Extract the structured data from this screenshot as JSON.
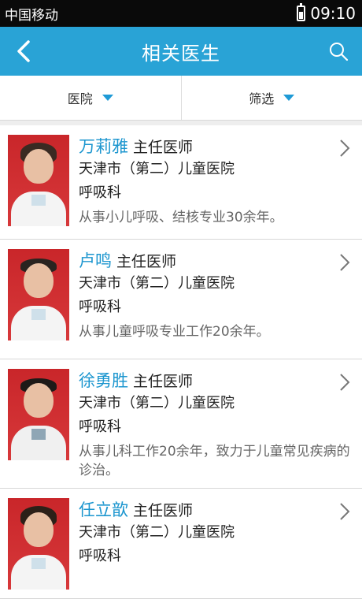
{
  "status_bar": {
    "carrier": "中国移动",
    "time": "09:10"
  },
  "header": {
    "title": "相关医生"
  },
  "filters": [
    {
      "label": "医院"
    },
    {
      "label": "筛选"
    }
  ],
  "doctors": [
    {
      "name": "万莉雅",
      "title": "主任医师",
      "hospital": "天津市（第二）儿童医院",
      "department": "呼吸科",
      "description": "从事小儿呼吸、结核专业30余年。"
    },
    {
      "name": "卢鸣",
      "title": "主任医师",
      "hospital": "天津市（第二）儿童医院",
      "department": "呼吸科",
      "description": "从事儿童呼吸专业工作20余年。"
    },
    {
      "name": "徐勇胜",
      "title": "主任医师",
      "hospital": "天津市（第二）儿童医院",
      "department": "呼吸科",
      "description": "从事儿科工作20余年，致力于儿童常见疾病的诊治。"
    },
    {
      "name": "任立歆",
      "title": "主任医师",
      "hospital": "天津市（第二）儿童医院",
      "department": "呼吸科",
      "description": ""
    }
  ],
  "colors": {
    "accent": "#29a3d6",
    "name_text": "#1c96cf",
    "photo_bg": "#c9262a"
  }
}
